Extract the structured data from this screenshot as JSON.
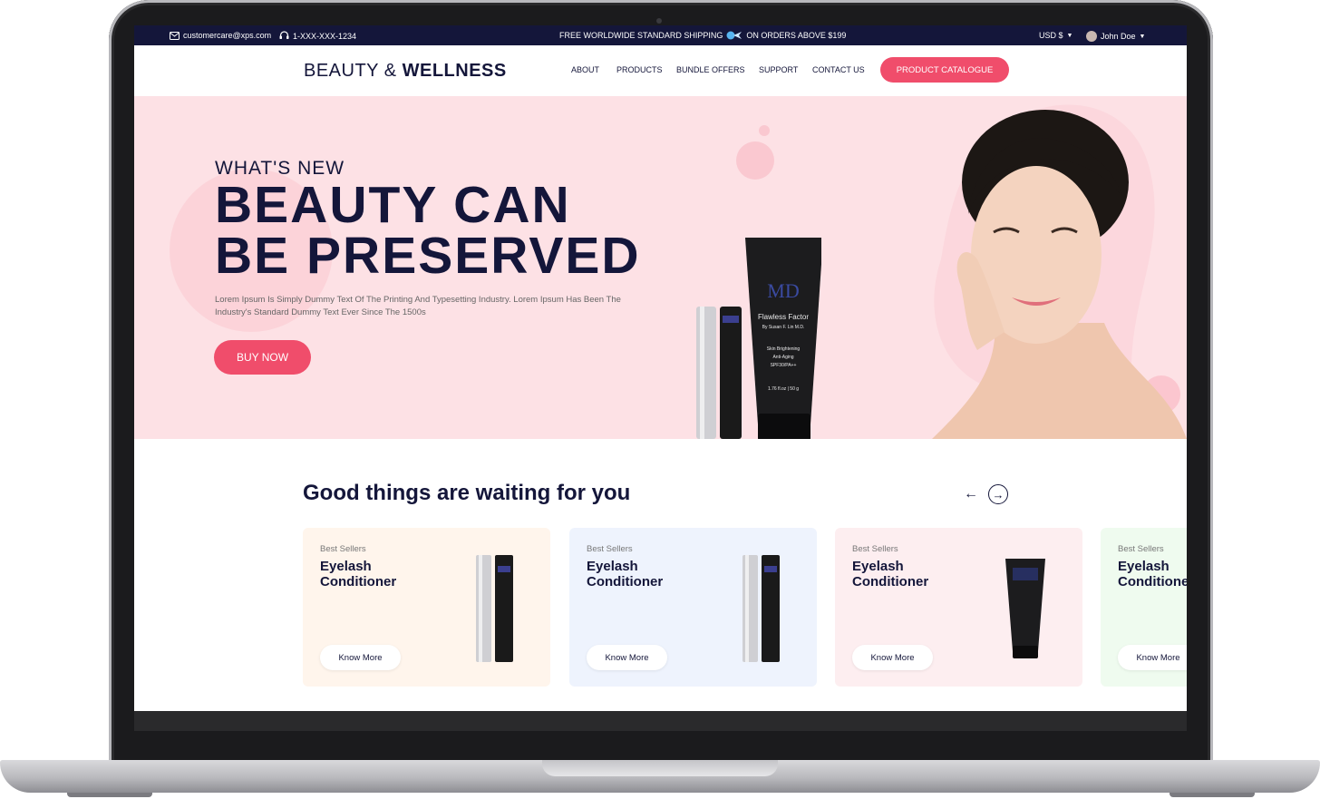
{
  "topbar": {
    "email": "customercare@xps.com",
    "phone": "1-XXX-XXX-1234",
    "shipping_left": "FREE WORLDWIDE STANDARD SHIPPING",
    "shipping_right": "ON ORDERS ABOVE $199",
    "currency": "USD $",
    "user": "John Doe",
    "icons": [
      "mail-icon",
      "headset-icon",
      "plane-icon",
      "chevron-down-icon",
      "avatar"
    ]
  },
  "header": {
    "logo_light": "BEAUTY &",
    "logo_bold": "WELLNESS",
    "nav": [
      "ABOUT",
      "PRODUCTS",
      "BUNDLE OFFERS",
      "SUPPORT",
      "CONTACT US"
    ],
    "cta": "PRODUCT CATALOGUE"
  },
  "hero": {
    "kicker": "WHAT'S NEW",
    "title_line1": "BEAUTY CAN",
    "title_line2": "BE PRESERVED",
    "description": "Lorem Ipsum Is Simply Dummy Text Of The Printing And Typesetting Industry. Lorem Ipsum Has Been The Industry's Standard Dummy Text Ever Since The 1500s",
    "button": "BUY NOW",
    "tube_brand": "MD",
    "tube_line1": "Flawless Factor",
    "tube_line2": "By Susan F. Lin M.D.",
    "tube_line3": "Skin Brightening",
    "tube_line4": "Anti-Aging",
    "tube_line5": "SPF30/PA++",
    "tube_size": "1.76 fl.oz | 50 g"
  },
  "products": {
    "title": "Good things are waiting for you",
    "prev_icon": "arrow-left-icon",
    "next_icon": "arrow-right-icon",
    "cards": [
      {
        "tag": "Best Sellers",
        "name1": "Eyelash",
        "name2": "Conditioner",
        "button": "Know More",
        "bg": "#fff5ec"
      },
      {
        "tag": "Best Sellers",
        "name1": "Eyelash",
        "name2": "Conditioner",
        "button": "Know More",
        "bg": "#eef3fd"
      },
      {
        "tag": "Best Sellers",
        "name1": "Eyelash",
        "name2": "Conditioner",
        "button": "Know More",
        "bg": "#fdeef0"
      },
      {
        "tag": "Best Sellers",
        "name1": "Eyelash",
        "name2": "Conditioner",
        "button": "Know More",
        "bg": "#effbef"
      }
    ]
  },
  "colors": {
    "navy": "#14163a",
    "accent": "#f04d6b",
    "hero_bg": "#fde1e5"
  }
}
